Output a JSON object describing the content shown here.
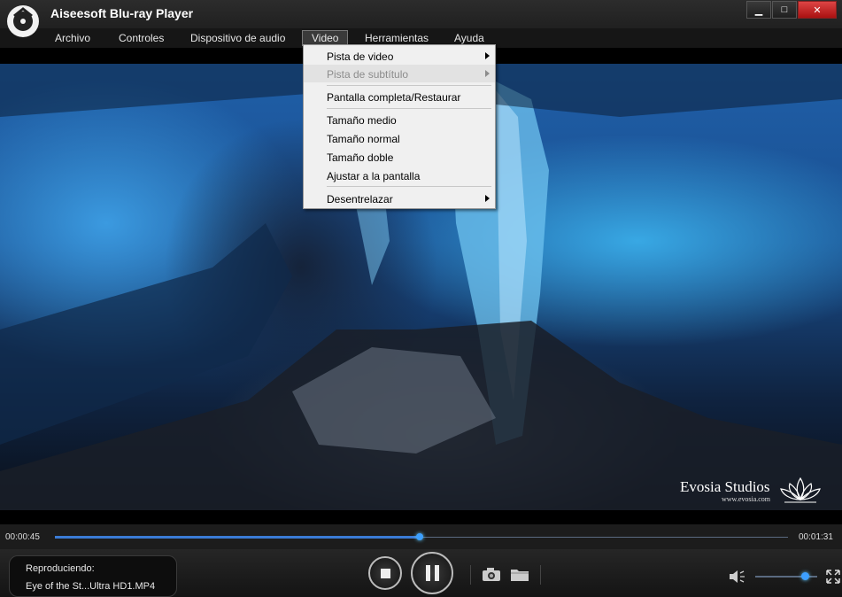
{
  "window": {
    "title": "Aiseesoft Blu-ray Player",
    "minimize_icon": "minimize-icon",
    "maximize_icon": "maximize-icon",
    "close_icon": "close-icon"
  },
  "menu": {
    "items": [
      {
        "label": "Archivo"
      },
      {
        "label": "Controles"
      },
      {
        "label": "Dispositivo de audio"
      },
      {
        "label": "Video"
      },
      {
        "label": "Herramientas"
      },
      {
        "label": "Ayuda"
      }
    ],
    "active": "Video"
  },
  "video_menu": {
    "items": [
      {
        "label": "Pista de video",
        "submenu": true,
        "enabled": true
      },
      {
        "label": "Pista de subtítulo",
        "submenu": true,
        "enabled": false
      },
      {
        "label": "Pantalla completa/Restaurar",
        "submenu": false,
        "enabled": true
      },
      {
        "label": "Tamaño medio",
        "submenu": false,
        "enabled": true
      },
      {
        "label": "Tamaño normal",
        "submenu": false,
        "enabled": true
      },
      {
        "label": "Tamaño doble",
        "submenu": false,
        "enabled": true
      },
      {
        "label": "Ajustar a la pantalla",
        "submenu": false,
        "enabled": true
      },
      {
        "label": "Desentrelazar",
        "submenu": true,
        "enabled": true
      }
    ]
  },
  "video": {
    "watermark": "Evosia Studios",
    "watermark_url": "www.evosia.com"
  },
  "playback": {
    "current_time": "00:00:45",
    "total_time": "00:01:31",
    "progress": 0.497
  },
  "now_playing": {
    "label": "Reproduciendo:",
    "file": "Eye of the St...Ultra HD1.MP4"
  },
  "volume": {
    "level": 0.8
  },
  "colors": {
    "accent": "#3da0ff",
    "close": "#c8262b",
    "menu_bg": "#f0f0f0"
  }
}
